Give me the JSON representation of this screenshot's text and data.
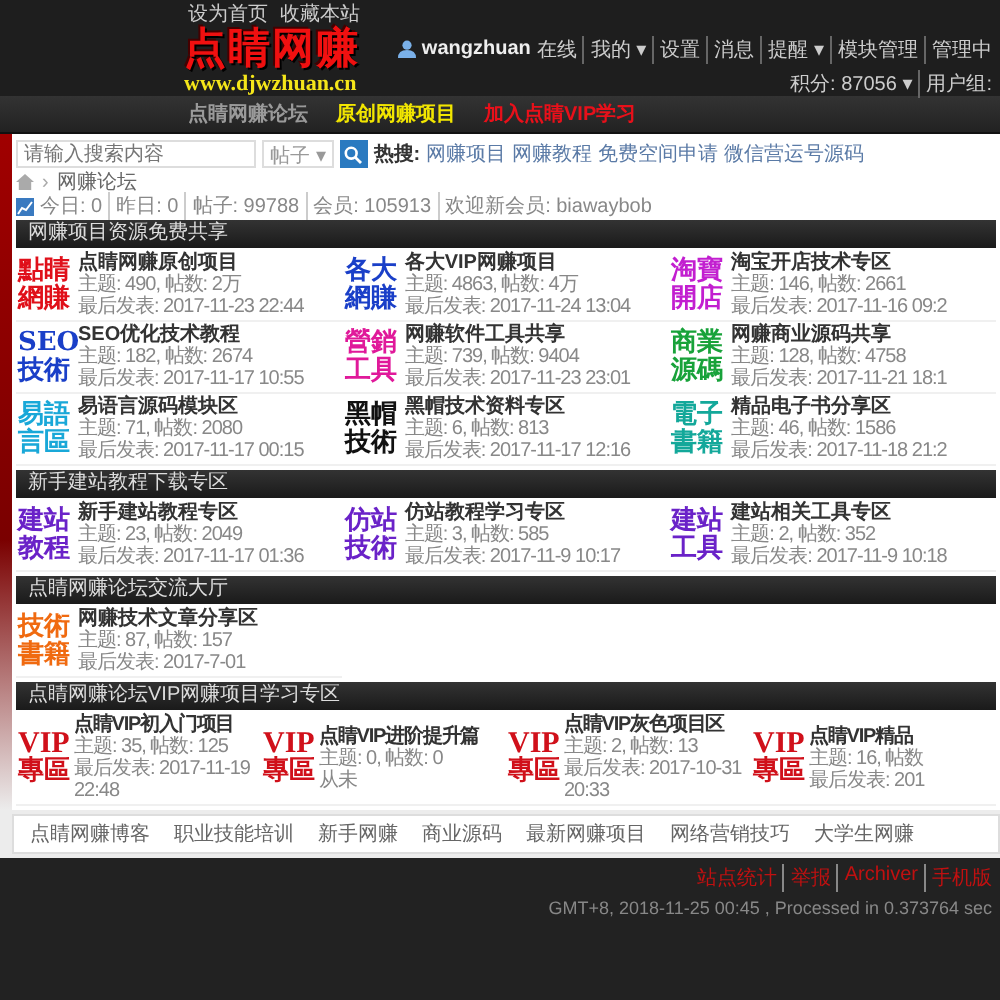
{
  "header": {
    "top_links": [
      "设为首页",
      "收藏本站"
    ],
    "logo": {
      "title": "点睛网赚",
      "url": "www.djwzhuan.cn"
    },
    "user_bar": {
      "username": "wangzhuan",
      "status": "在线",
      "links": [
        "我的 ▾",
        "设置",
        "消息",
        "提醒 ▾",
        "模块管理",
        "管理中"
      ],
      "points": "积分: 87056 ▾",
      "group": "用户组:"
    }
  },
  "nav": [
    {
      "label": "点睛网赚论坛",
      "color": "#9a9a9a"
    },
    {
      "label": "原创网赚项目",
      "color": "#f2e600"
    },
    {
      "label": "加入点睛VIP学习",
      "color": "#e8101a"
    }
  ],
  "search": {
    "placeholder": "请输入搜索内容",
    "scope": "帖子 ▾",
    "hot_label": "热搜:",
    "hot": [
      "网赚项目",
      "网赚教程",
      "免费空间申请",
      "微信营运号源码"
    ]
  },
  "breadcrumb": {
    "separator": "›",
    "items": [
      "网赚论坛"
    ]
  },
  "stats": [
    "今日: 0",
    "昨日: 0",
    "帖子: 99788",
    "会员: 105913",
    "欢迎新会员: biawaybob"
  ],
  "sections": [
    {
      "title": "网赚项目资源免费共享",
      "kind": "standard",
      "forums": [
        {
          "icon": [
            "點睛",
            "網賺"
          ],
          "color": "#e0101a",
          "name": "点睛网赚原创项目",
          "counts": "主题: 490, 帖数: 2万",
          "last_post": "最后发表: 2017-11-23 22:44"
        },
        {
          "icon": [
            "各大",
            "網賺"
          ],
          "color": "#1a3fc8",
          "name": "各大VIP网赚项目",
          "counts": "主题: 4863, 帖数: 4万",
          "last_post": "最后发表: 2017-11-24 13:04"
        },
        {
          "icon": [
            "淘寶",
            "開店"
          ],
          "color": "#c21ed0",
          "name": "淘宝开店技术专区",
          "counts": "主题: 146, 帖数: 2661",
          "last_post": "最后发表: 2017-11-16 09:2"
        },
        {
          "icon": [
            "SEO",
            "技術"
          ],
          "color": "#1a3fc8",
          "name": "SEO优化技术教程",
          "counts": "主题: 182, 帖数: 2674",
          "last_post": "最后发表: 2017-11-17 10:55"
        },
        {
          "icon": [
            "營銷",
            "工具"
          ],
          "color": "#e0199a",
          "name": "网赚软件工具共享",
          "counts": "主题: 739, 帖数: 9404",
          "last_post": "最后发表: 2017-11-23 23:01"
        },
        {
          "icon": [
            "商業",
            "源碼"
          ],
          "color": "#18a23a",
          "name": "网赚商业源码共享",
          "counts": "主题: 128, 帖数: 4758",
          "last_post": "最后发表: 2017-11-21 18:1"
        },
        {
          "icon": [
            "易語",
            "言區"
          ],
          "color": "#19a8d8",
          "name": "易语言源码模块区",
          "counts": "主题: 71, 帖数: 2080",
          "last_post": "最后发表: 2017-11-17 00:15"
        },
        {
          "icon": [
            "黑帽",
            "技術"
          ],
          "color": "#111111",
          "name": "黑帽技术资料专区",
          "counts": "主题: 6, 帖数: 813",
          "last_post": "最后发表: 2017-11-17 12:16"
        },
        {
          "icon": [
            "電子",
            "書籍"
          ],
          "color": "#13a89a",
          "name": "精品电子书分享区",
          "counts": "主题: 46, 帖数: 1586",
          "last_post": "最后发表: 2017-11-18 21:2"
        }
      ]
    },
    {
      "title": "新手建站教程下载专区",
      "kind": "standard",
      "forums": [
        {
          "icon": [
            "建站",
            "教程"
          ],
          "color": "#6a22c8",
          "name": "新手建站教程专区",
          "counts": "主题: 23, 帖数: 2049",
          "last_post": "最后发表: 2017-11-17 01:36"
        },
        {
          "icon": [
            "仿站",
            "技術"
          ],
          "color": "#6a22c8",
          "name": "仿站教程学习专区",
          "counts": "主题: 3, 帖数: 585",
          "last_post": "最后发表: 2017-11-9 10:17"
        },
        {
          "icon": [
            "建站",
            "工具"
          ],
          "color": "#6a22c8",
          "name": "建站相关工具专区",
          "counts": "主题: 2, 帖数: 352",
          "last_post": "最后发表: 2017-11-9 10:18"
        }
      ]
    },
    {
      "title": "点睛网赚论坛交流大厅",
      "kind": "standard",
      "forums": [
        {
          "icon": [
            "技術",
            "書籍"
          ],
          "color": "#f06a10",
          "name": "网赚技术文章分享区",
          "counts": "主题: 87, 帖数: 157",
          "last_post": "最后发表: 2017-7-01"
        }
      ]
    },
    {
      "title": "点睛网赚论坛VIP网赚项目学习专区",
      "kind": "vip",
      "forums": [
        {
          "icon": [
            "VIP",
            "專區"
          ],
          "color": "#d0101a",
          "name": "点睛VIP初入门项目",
          "counts": "主题: 35, 帖数: 125",
          "last_post": "最后发表: 2017-11-19 22:48"
        },
        {
          "icon": [
            "VIP",
            "專區"
          ],
          "color": "#d0101a",
          "name": "点睛VIP进阶提升篇",
          "counts": "主题: 0, 帖数: 0",
          "last_post": "从未"
        },
        {
          "icon": [
            "VIP",
            "專區"
          ],
          "color": "#d0101a",
          "name": "点睛VIP灰色项目区",
          "counts": "主题: 2, 帖数: 13",
          "last_post": "最后发表: 2017-10-31 20:33"
        },
        {
          "icon": [
            "VIP",
            "專區"
          ],
          "color": "#d0101a",
          "name": "点睛VIP精品",
          "counts": "主题: 16, 帖数",
          "last_post": "最后发表: 201"
        }
      ]
    }
  ],
  "links": [
    "点睛网赚博客",
    "职业技能培训",
    "新手网赚",
    "商业源码",
    "最新网赚项目",
    "网络营销技巧",
    "大学生网赚"
  ],
  "footer": {
    "links": [
      "站点统计",
      "举报",
      "Archiver",
      "手机版"
    ],
    "info": "GMT+8, 2018-11-25 00:45 , Processed in 0.373764 sec"
  }
}
